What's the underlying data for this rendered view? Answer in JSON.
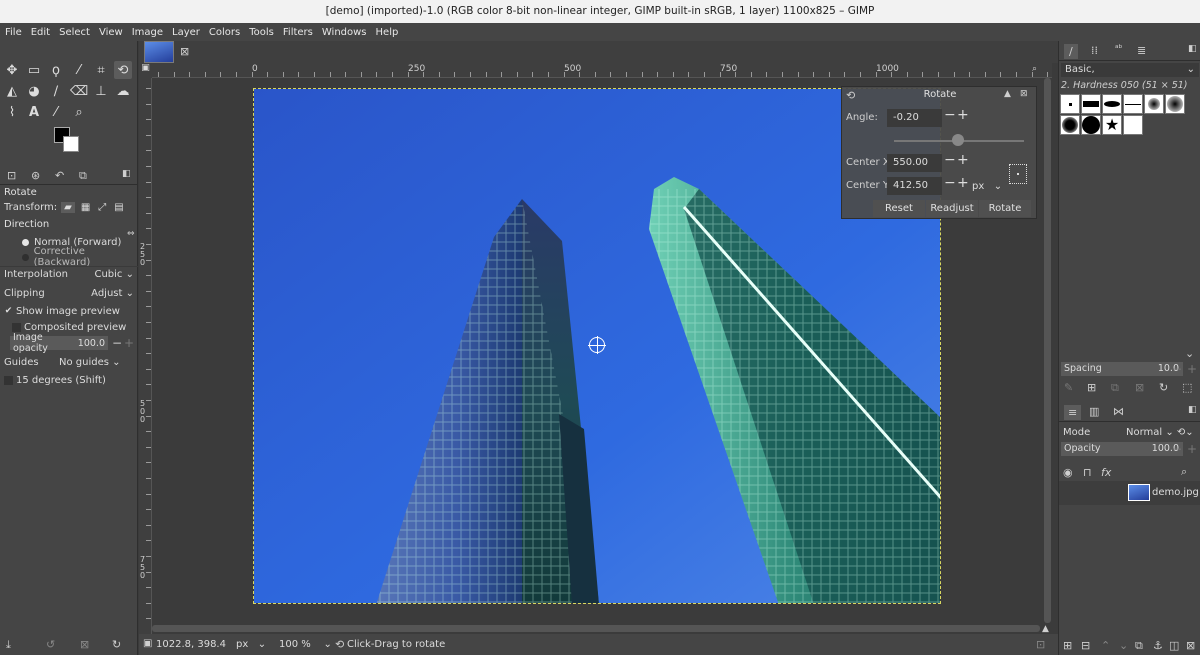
{
  "window": {
    "title": "[demo] (imported)-1.0 (RGB color 8-bit non-linear integer, GIMP built-in sRGB, 1 layer) 1100x825 – GIMP"
  },
  "menu": [
    "File",
    "Edit",
    "Select",
    "View",
    "Image",
    "Layer",
    "Colors",
    "Tools",
    "Filters",
    "Windows",
    "Help"
  ],
  "tool_options": {
    "title": "Rotate",
    "transform_label": "Transform:",
    "direction_label": "Direction",
    "direction_normal": "Normal (Forward)",
    "direction_corrective": "Corrective (Backward)",
    "interpolation_label": "Interpolation",
    "interpolation_value": "Cubic",
    "clipping_label": "Clipping",
    "clipping_value": "Adjust",
    "show_preview": "Show image preview",
    "composited_preview": "Composited preview",
    "image_opacity_label": "Image opacity",
    "image_opacity_value": "100.0",
    "guides_label": "Guides",
    "guides_value": "No guides",
    "constrain": "15 degrees (Shift)"
  },
  "rulers": {
    "h": [
      "0",
      "250",
      "500",
      "750",
      "1000"
    ],
    "v": [
      "250",
      "500",
      "750"
    ]
  },
  "rotate_dialog": {
    "title": "Rotate",
    "angle_label": "Angle:",
    "angle_value": "-0.20",
    "center_x_label": "Center X:",
    "center_x_value": "550.00",
    "center_y_label": "Center Y:",
    "center_y_value": "412.50",
    "unit": "px",
    "reset": "Reset",
    "readjust": "Readjust",
    "rotate": "Rotate"
  },
  "brushes": {
    "preset": "Basic,",
    "brush_name": "2. Hardness 050 (51 × 51)",
    "spacing_label": "Spacing",
    "spacing_value": "10.0"
  },
  "layers": {
    "mode_label": "Mode",
    "mode_value": "Normal",
    "opacity_label": "Opacity",
    "opacity_value": "100.0",
    "layer_name": "demo.jpg"
  },
  "status": {
    "coords": "1022.8, 398.4",
    "unit": "px",
    "zoom": "100 %",
    "message": "Click-Drag to rotate"
  },
  "colors": {
    "sky": "#2d5fd6",
    "accent": "#5a5a5a"
  }
}
